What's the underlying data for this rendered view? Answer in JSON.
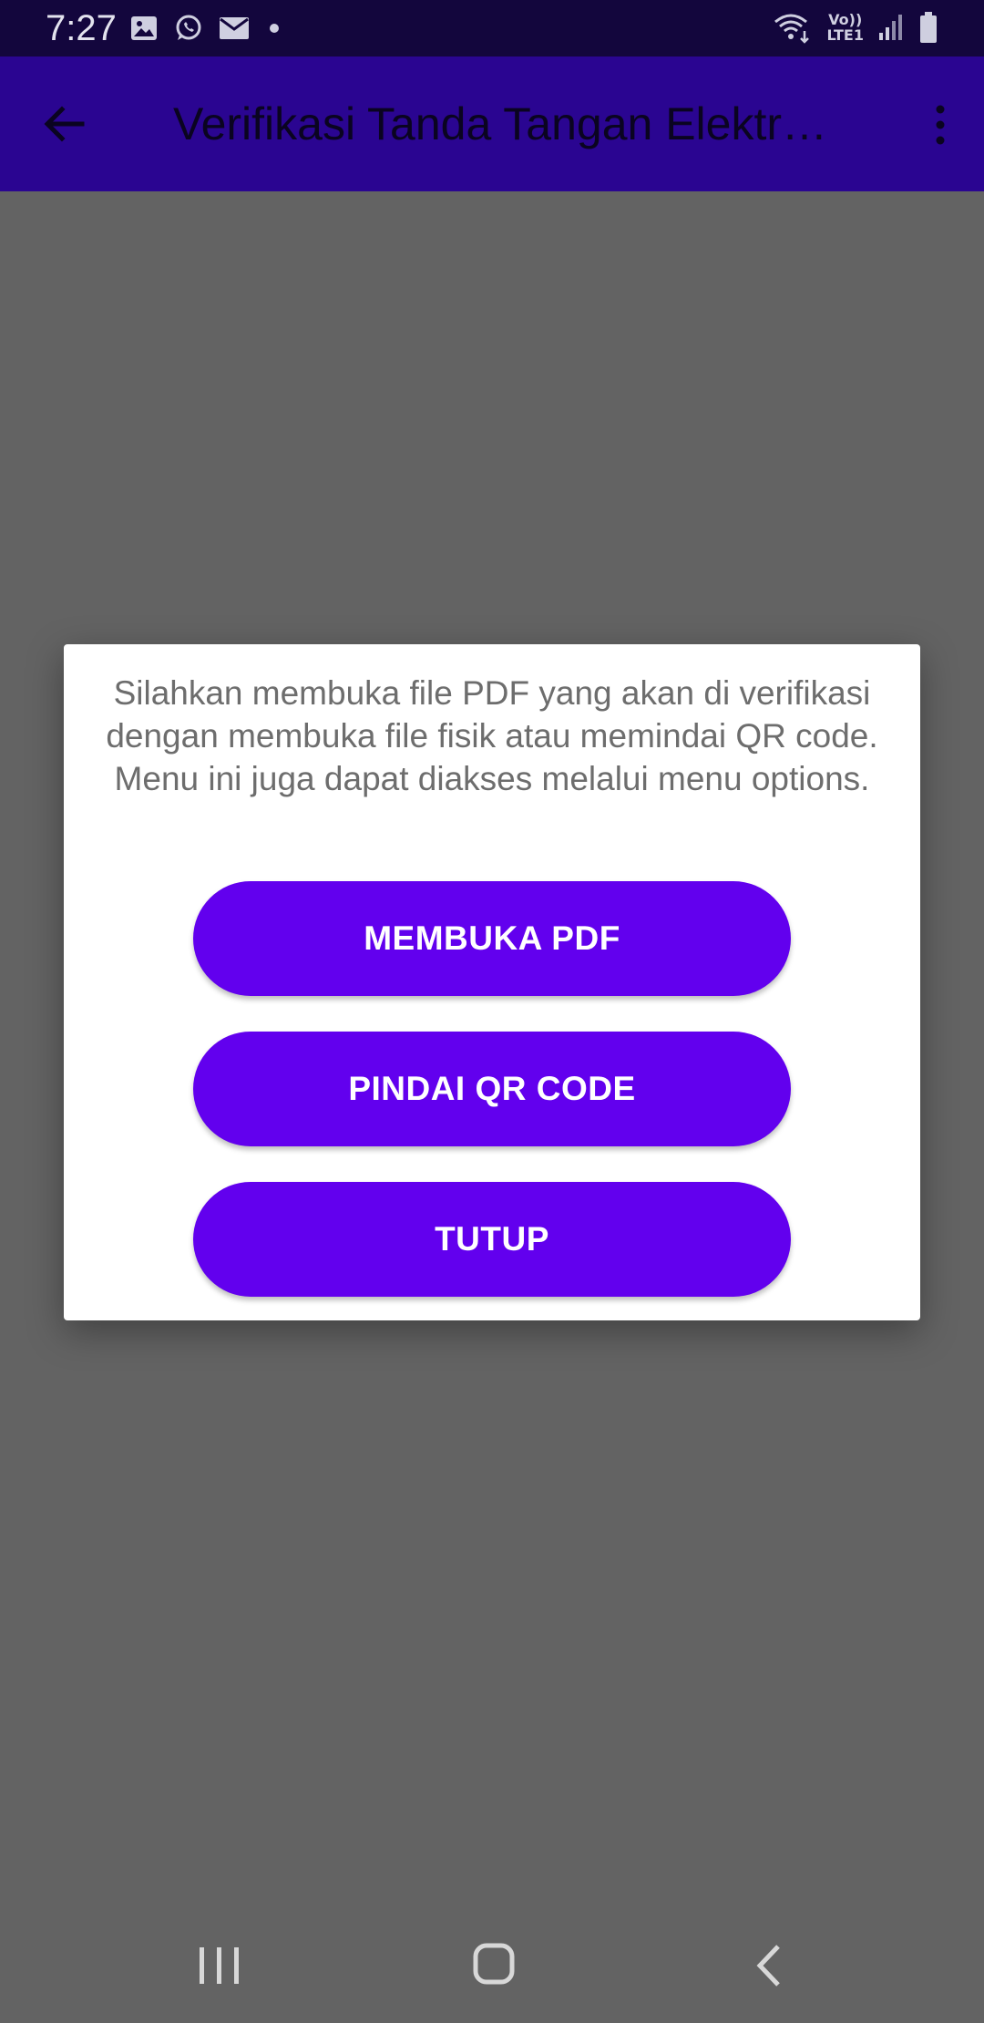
{
  "status_bar": {
    "time": "7:27",
    "left_icons": [
      "image-icon",
      "whatsapp-icon",
      "mail-icon",
      "dot-icon"
    ],
    "right_icons": [
      "wifi-icon",
      "volte-icon",
      "signal-icon",
      "battery-icon"
    ],
    "volte_label": "Vo))",
    "lte_label": "LTE1"
  },
  "app_bar": {
    "title": "Verifikasi Tanda Tangan Elektr…",
    "background": "#2a0591"
  },
  "dialog": {
    "message": "Silahkan membuka file PDF yang akan di verifikasi dengan membuka file fisik atau memindai QR code. Menu ini juga dapat diakses melalui menu options.",
    "buttons": {
      "open_pdf": "MEMBUKA PDF",
      "scan_qr": "PINDAI QR CODE",
      "close": "TUTUP"
    },
    "button_color": "#6200ee"
  },
  "nav_bar": {
    "icons": [
      "recents-icon",
      "home-icon",
      "back-icon"
    ]
  }
}
